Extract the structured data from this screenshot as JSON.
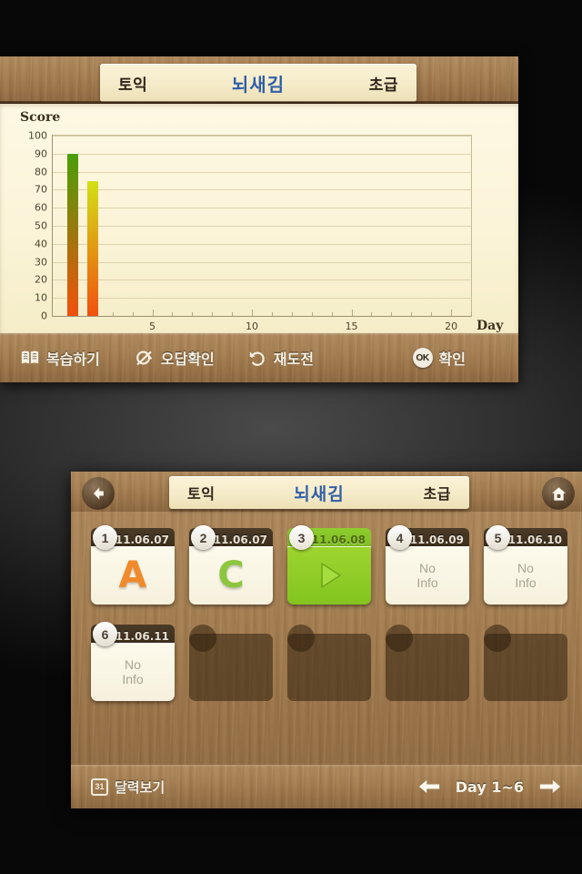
{
  "chart_screen": {
    "header": {
      "left_label": "토익",
      "center_label": "뇌새김",
      "right_label": "초급"
    },
    "toolbar": {
      "review_label": "복습하기",
      "wrong_answers_label": "오답확인",
      "retry_label": "재도전",
      "confirm_label": "확인",
      "confirm_badge": "OK"
    }
  },
  "chart_data": {
    "type": "bar",
    "title": "",
    "ylabel": "Score",
    "xlabel": "Day",
    "x": [
      1,
      2
    ],
    "values": [
      90,
      75
    ],
    "ylim": [
      0,
      100
    ],
    "xlim": [
      0,
      21
    ],
    "ytick_labels": [
      "100",
      "90",
      "80",
      "70",
      "60",
      "50",
      "40",
      "30",
      "20",
      "10",
      "0"
    ],
    "ytick_values": [
      100,
      90,
      80,
      70,
      60,
      50,
      40,
      30,
      20,
      10,
      0
    ],
    "xtick_labels": [
      "5",
      "10",
      "15",
      "20"
    ],
    "xtick_values": [
      5,
      10,
      15,
      20
    ],
    "grid": true,
    "legend": "none",
    "bar_colors_top": [
      "#4a9e0a",
      "#d2e016"
    ],
    "bar_colors_bottom": [
      "#f2500f",
      "#f2500f"
    ],
    "plot_background": "#fbf4d8"
  },
  "days_screen": {
    "header": {
      "left_label": "토익",
      "center_label": "뇌새김",
      "right_label": "초급",
      "back_icon": "arrow-left-icon",
      "home_icon": "home-icon"
    },
    "cards": [
      {
        "number": "1",
        "date": "11.06.07",
        "content": "A",
        "content_type": "letter",
        "color": "#f08a2a",
        "state": "done"
      },
      {
        "number": "2",
        "date": "11.06.07",
        "content": "C",
        "content_type": "letter",
        "color": "#8cc63f",
        "state": "done"
      },
      {
        "number": "3",
        "date": "11.06.08",
        "content": "",
        "content_type": "play",
        "color": "#ffffff",
        "state": "active"
      },
      {
        "number": "4",
        "date": "11.06.09",
        "content": "No Info",
        "content_type": "noinfo",
        "color": "#a9a392",
        "state": "empty"
      },
      {
        "number": "5",
        "date": "11.06.10",
        "content": "No Info",
        "content_type": "noinfo",
        "color": "#a9a392",
        "state": "empty"
      },
      {
        "number": "6",
        "date": "11.06.11",
        "content": "No Info",
        "content_type": "noinfo",
        "color": "#a9a392",
        "state": "empty"
      }
    ],
    "placeholder_count": 4,
    "bottom_bar": {
      "calendar_badge": "31",
      "calendar_label": "달력보기",
      "pager_label": "Day 1~6",
      "prev_icon": "arrow-left-icon",
      "next_icon": "arrow-right-icon"
    }
  }
}
